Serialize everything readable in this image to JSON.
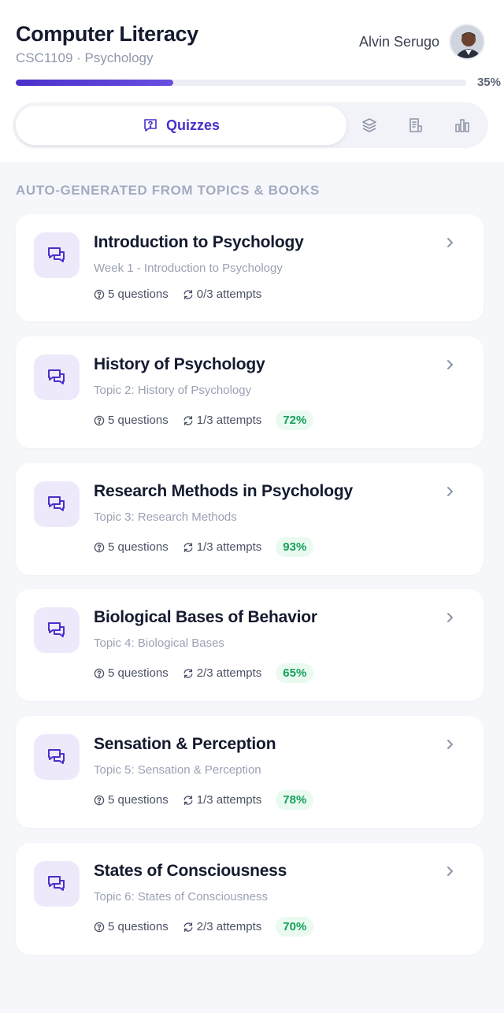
{
  "header": {
    "course_title": "Computer Literacy",
    "course_subtitle": "CSC1109 · Psychology",
    "user_name": "Alvin Serugo",
    "progress_percent": 35,
    "progress_label": "35%"
  },
  "tabs": {
    "active_label": "Quizzes",
    "items": [
      "quizzes",
      "layers",
      "notes",
      "stats"
    ]
  },
  "section_label": "AUTO-GENERATED FROM TOPICS & BOOKS",
  "quizzes": [
    {
      "title": "Introduction to Psychology",
      "subtitle": "Week 1 - Introduction to Psychology",
      "questions": "5 questions",
      "attempts": "0/3 attempts",
      "score": ""
    },
    {
      "title": "History of Psychology",
      "subtitle": "Topic 2: History of Psychology",
      "questions": "5 questions",
      "attempts": "1/3 attempts",
      "score": "72%"
    },
    {
      "title": "Research Methods in Psychology",
      "subtitle": "Topic 3: Research Methods",
      "questions": "5 questions",
      "attempts": "1/3 attempts",
      "score": "93%"
    },
    {
      "title": "Biological Bases of Behavior",
      "subtitle": "Topic 4: Biological Bases",
      "questions": "5 questions",
      "attempts": "2/3 attempts",
      "score": "65%"
    },
    {
      "title": "Sensation & Perception",
      "subtitle": "Topic 5: Sensation & Perception",
      "questions": "5 questions",
      "attempts": "1/3 attempts",
      "score": "78%"
    },
    {
      "title": "States of Consciousness",
      "subtitle": "Topic 6: States of Consciousness",
      "questions": "5 questions",
      "attempts": "2/3 attempts",
      "score": "70%"
    }
  ],
  "colors": {
    "accent": "#4b2fc9",
    "score_text": "#15a05a",
    "score_bg": "#eafaf1",
    "icon_bg": "#ede9fb"
  }
}
